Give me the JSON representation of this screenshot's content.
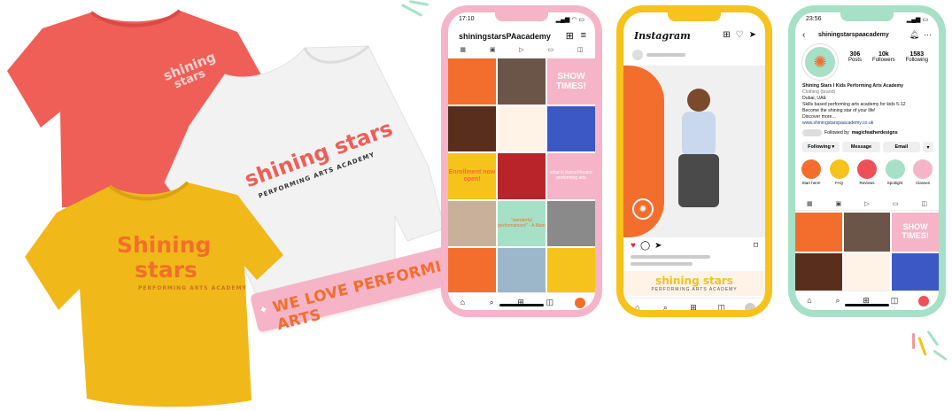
{
  "shirts": {
    "red": {
      "line1": "shining",
      "line2": "stars"
    },
    "white": {
      "title": "shining stars",
      "subtitle": "PERFORMING ARTS ACADEMY"
    },
    "yellow": {
      "line1": "Shining",
      "line2": "stars",
      "subtitle": "PERFORMING ARTS ACADEMY"
    }
  },
  "banner": {
    "text": "WE LOVE PERFORMING ARTS"
  },
  "phone1": {
    "time": "17:10",
    "username": "shiningstarsPAacademy",
    "tiles": {
      "show_times": "SHOW TIMES!",
      "enrollment": "Enrollment now open!",
      "wonderful": "\"wonderful performances!\" - A Mum",
      "shining": "shining stars",
      "sessions": "what is dance/theatre performing arts"
    }
  },
  "phone2": {
    "app_name": "Instagram",
    "brand": "shining stars",
    "brand_sub": "PERFORMING ARTS ACADEMY"
  },
  "phone3": {
    "time": "23:56",
    "username": "shiningstarspaacademy",
    "stats": [
      {
        "value": "306",
        "label": "Posts"
      },
      {
        "value": "10k",
        "label": "Followers"
      },
      {
        "value": "1583",
        "label": "Following"
      }
    ],
    "bio_name": "Shining Stars I Kids Performing Arts Academy",
    "bio_category": "Clothing (brand)",
    "bio_lines": [
      "Dubai, UAE",
      "Skills based performing arts academy for kids 5-12",
      "Become the shining star of your life!",
      "Discover more..."
    ],
    "bio_link": "www.shiningstarspaacademy.co.uk",
    "followed_by_prefix": "Followed by",
    "followed_by_name": "magicfeatherdesigns",
    "buttons": {
      "following": "Following",
      "message": "Message",
      "email": "Email"
    },
    "highlights": [
      {
        "label": "Start here!",
        "color": "#f36e2c"
      },
      {
        "label": "FAQ",
        "color": "#f6c21c"
      },
      {
        "label": "Reviews",
        "color": "#ee4f58"
      },
      {
        "label": "Spotlight",
        "color": "#a6e0c6"
      },
      {
        "label": "Classes",
        "color": "#f6b4c8"
      }
    ],
    "tiles": {
      "show_times": "SHOW TIMES!"
    }
  },
  "colors": {
    "coral": "#ef5e57",
    "orange": "#f36e2c",
    "yellow": "#f6c21c",
    "pink": "#f6b4c8",
    "mint": "#a6e0c6",
    "white_shirt": "#f2f2f2"
  }
}
